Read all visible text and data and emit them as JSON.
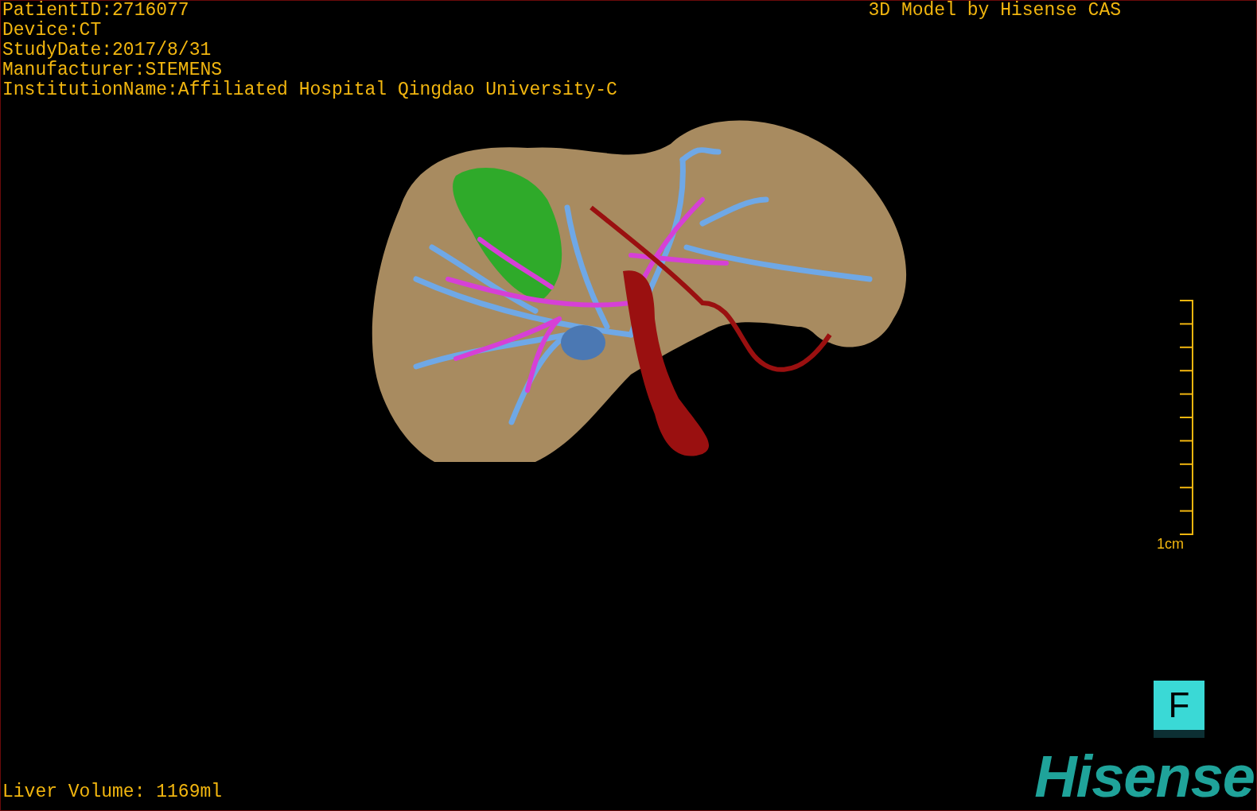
{
  "info_lines": [
    "PatientID:2716077",
    "Device:CT",
    "StudyDate:2017/8/31",
    "Manufacturer:SIEMENS",
    "InstitutionName:Affiliated Hospital Qingdao University-C"
  ],
  "credit": "3D Model by Hisense CAS",
  "scale_bar": {
    "label": "1cm"
  },
  "orientation_cube": {
    "face": "F"
  },
  "volume": "Liver Volume: 1169ml",
  "logo": "Hisense"
}
